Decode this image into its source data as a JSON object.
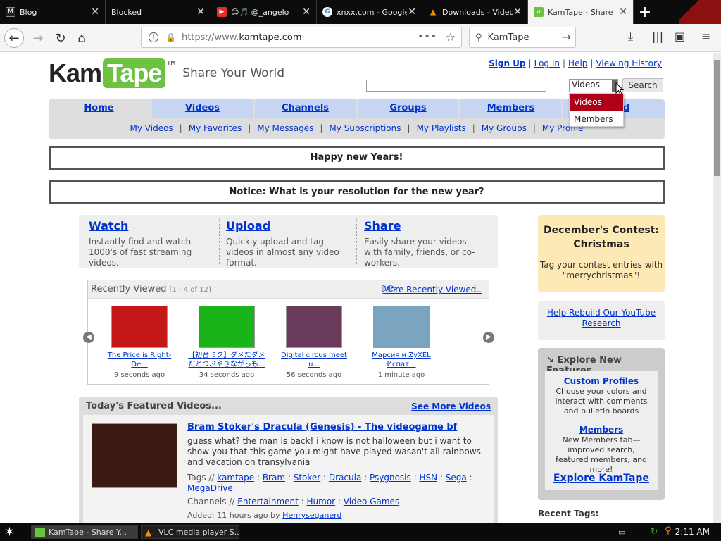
{
  "browser": {
    "tabs": [
      {
        "title": "Blog",
        "icon": "m-favicon"
      },
      {
        "title": "Blocked",
        "icon": "blocked-favicon"
      },
      {
        "title": "😊🎵 @_angelo",
        "icon": "youtube-favicon"
      },
      {
        "title": "xnxx.com - Google",
        "icon": "google-favicon"
      },
      {
        "title": "Downloads - Video",
        "icon": "vlc-favicon"
      },
      {
        "title": "KamTape - Share",
        "icon": "kamtape-favicon"
      }
    ],
    "url_prefix": "https://www.",
    "url_domain": "kamtape.com",
    "search_text": "KamTape"
  },
  "site": {
    "logo_part1": "Kam",
    "logo_part2": "Tape",
    "logo_tm": "TM",
    "slogan": "Share Your World",
    "toplinks": [
      "Sign Up",
      "Log In",
      "Help",
      "Viewing History"
    ],
    "search_select": "Videos",
    "search_button": "Search",
    "dropdown": [
      "Videos",
      "Members"
    ],
    "nav_tabs": [
      "Home",
      "Videos",
      "Channels",
      "Groups",
      "Members",
      "Upload"
    ],
    "nav_visible_upload": "d",
    "subnav": [
      "My Videos",
      "My Favorites",
      "My Messages",
      "My Subscriptions",
      "My Playlists",
      "My Groups",
      "My Profile"
    ],
    "notice1": "Happy new Years!",
    "notice2": "Notice: What is your resolution for the new year?"
  },
  "wus": [
    {
      "title": "Watch",
      "text": "Instantly find and watch 1000's of fast streaming videos."
    },
    {
      "title": "Upload",
      "text": "Quickly upload and tag videos in almost any video format."
    },
    {
      "title": "Share",
      "text": "Easily share your videos with family, friends, or co-workers."
    }
  ],
  "contest": {
    "title": "December's Contest: Christmas",
    "text": "Tag your contest entries with \"merrychristmas\"!"
  },
  "recent": {
    "title": "Recently Viewed",
    "count": "[1 - 4 of 12]",
    "more": "More Recently Viewed..",
    "items": [
      {
        "title": "The Price is Right-De...",
        "ago": "9 seconds ago",
        "color": "#c41818"
      },
      {
        "title": "【初音ミク】ダメだダメだとつぶやきながらも...",
        "ago": "34 seconds ago",
        "color": "#1ab41a"
      },
      {
        "title": "Digital circus meet u...",
        "ago": "56 seconds ago",
        "color": "#6a3a5a"
      },
      {
        "title": "Марсия и ZyXEL Испат...",
        "ago": "1 minute ago",
        "color": "#7aa4c0"
      }
    ]
  },
  "youtube_link": "Help Rebuild Our YouTube Research",
  "explore": {
    "title": "Explore New Features",
    "f1_title": "Custom Profiles",
    "f1_text": "Choose your colors and interact with comments and bulletin boards",
    "f2_title": "Members",
    "f2_text": "New Members tab—improved search, featured members, and more!",
    "link": "Explore KamTape"
  },
  "recent_tags": "Recent Tags:",
  "featured": {
    "header": "Today's Featured Videos...",
    "more": "See More Videos",
    "title": "Bram Stoker's Dracula (Genesis) - The videogame bf",
    "desc": "guess what? the man is back! i know is not halloween but i want to show you that this game you might have played wasan't all rainbows and vacation on transylvania",
    "tags_label": "Tags //",
    "tags": [
      "kamtape",
      "Bram",
      "Stoker",
      "Dracula",
      "Psygnosis",
      "HSN",
      "Sega",
      "MegaDrive"
    ],
    "channels_label": "Channels //",
    "channels": [
      "Entertainment",
      "Humor",
      "Video Games"
    ],
    "added": "Added: 11 hours ago by",
    "user": "Henryseganerd"
  },
  "taskbar": {
    "items": [
      "KamTape - Share Y...",
      "VLC media player S..."
    ],
    "clock": "2:11 AM"
  }
}
